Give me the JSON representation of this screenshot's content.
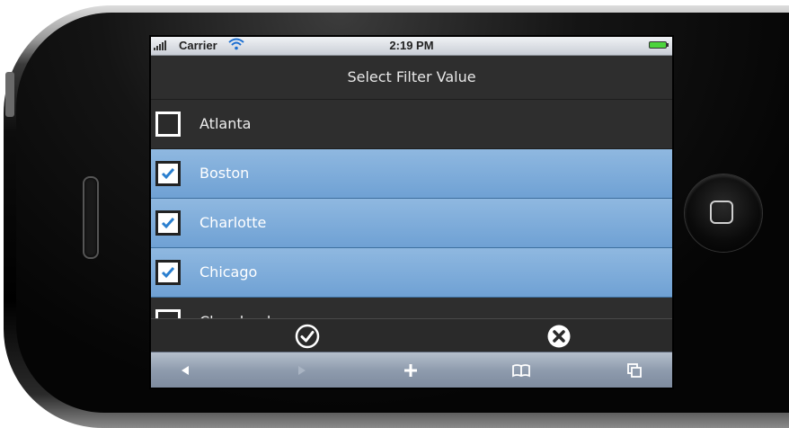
{
  "status_bar": {
    "carrier": "Carrier",
    "time": "2:19 PM",
    "signal_icon": "signal-bars-icon",
    "wifi_icon": "wifi-icon",
    "battery_icon": "battery-icon"
  },
  "header": {
    "title": "Select Filter Value"
  },
  "filter_list": {
    "items": [
      {
        "label": "Atlanta",
        "checked": false
      },
      {
        "label": "Boston",
        "checked": true
      },
      {
        "label": "Charlotte",
        "checked": true
      },
      {
        "label": "Chicago",
        "checked": true
      },
      {
        "label": "Cleveland",
        "checked": false
      }
    ]
  },
  "action_bar": {
    "confirm_icon": "check-circle-icon",
    "cancel_icon": "close-circle-icon"
  },
  "browser_toolbar": {
    "back_icon": "back-arrow-icon",
    "forward_icon": "forward-arrow-icon",
    "add_icon": "plus-icon",
    "bookmarks_icon": "bookmarks-book-icon",
    "pages_icon": "pages-icon"
  },
  "colors": {
    "selected_row": "#7aaadb",
    "row_background": "#2e2e2e",
    "toolbar": "#8e9bad"
  }
}
